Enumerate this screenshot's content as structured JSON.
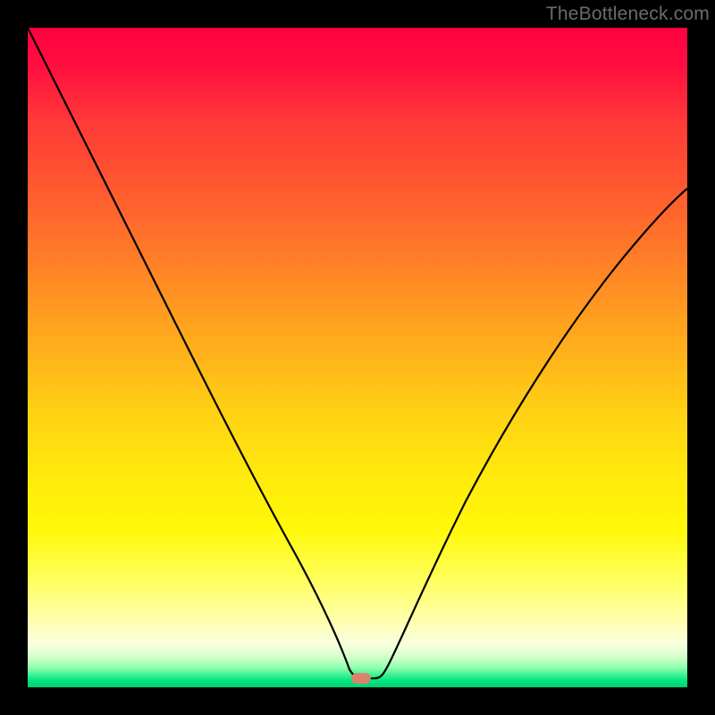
{
  "watermark": "TheBottleneck.com",
  "marker": {
    "cx_frac": 0.505,
    "cy_frac": 0.987
  },
  "colors": {
    "curve": "#000000",
    "marker": "#d9836e"
  },
  "chart_data": {
    "type": "line",
    "title": "",
    "xlabel": "",
    "ylabel": "",
    "xlim": [
      0,
      1
    ],
    "ylim": [
      0,
      1
    ],
    "series": [
      {
        "name": "bottleneck-curve",
        "x": [
          0.0,
          0.05,
          0.1,
          0.15,
          0.2,
          0.25,
          0.3,
          0.35,
          0.4,
          0.43,
          0.46,
          0.48,
          0.5,
          0.52,
          0.54,
          0.56,
          0.6,
          0.65,
          0.7,
          0.75,
          0.8,
          0.85,
          0.9,
          0.95,
          1.0
        ],
        "y": [
          1.0,
          0.88,
          0.77,
          0.66,
          0.56,
          0.46,
          0.36,
          0.26,
          0.15,
          0.09,
          0.045,
          0.02,
          0.01,
          0.01,
          0.02,
          0.05,
          0.12,
          0.21,
          0.3,
          0.38,
          0.46,
          0.53,
          0.59,
          0.65,
          0.7
        ]
      }
    ]
  }
}
